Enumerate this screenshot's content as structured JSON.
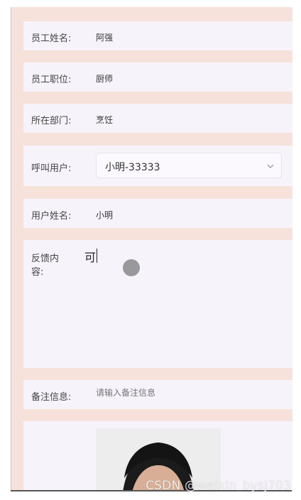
{
  "form": {
    "employee_name": {
      "label": "员工姓名:",
      "value": "阿强"
    },
    "employee_position": {
      "label": "员工职位:",
      "value": "厨师"
    },
    "department": {
      "label": "所在部门:",
      "value": "烹饪"
    },
    "call_user": {
      "label": "呼叫用户:",
      "value": "小明-33333"
    },
    "user_name": {
      "label": "用户姓名:",
      "value": "小明"
    },
    "feedback": {
      "label_line1": "反馈内",
      "label_line2": "容:",
      "value": "可"
    },
    "remark": {
      "label": "备注信息:",
      "placeholder": "请输入备注信息"
    }
  },
  "watermark": "CSDN @weixin_bysj703",
  "icons": {
    "dropdown": "chevron-down-icon",
    "photo": "person-photo",
    "cursor": "touch-cursor-indicator"
  },
  "colors": {
    "background": "#f6e2da",
    "row": "#f7f3fb"
  }
}
